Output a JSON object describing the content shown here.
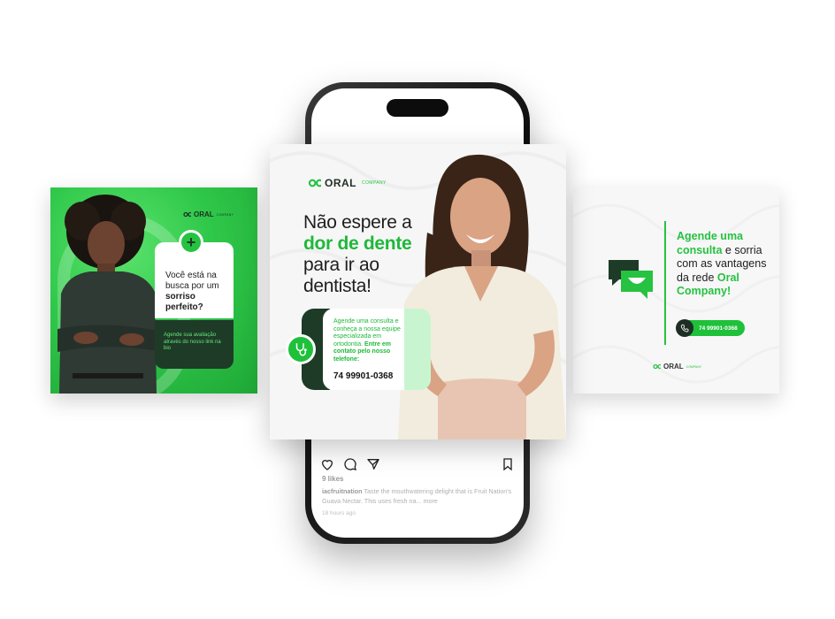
{
  "colors": {
    "brand_green": "#26c241",
    "dark_green": "#1e3b27",
    "mint": "#c8f5d0"
  },
  "instagram": {
    "likes": "9 likes",
    "username": "iacfruitnation",
    "caption": "Taste the mouthwatering delight that is Fruit Nation's Guava Nectar. This uses fresh na...",
    "more": "more",
    "time": "18 hours ago",
    "icons": [
      "heart-icon",
      "comment-icon",
      "share-icon",
      "bookmark-icon"
    ]
  },
  "left_card": {
    "logo": "ORAL",
    "logo_small": "COMPANY",
    "question_1": "Você está na busca por um",
    "question_bold": "sorriso perfeito?",
    "note": "Agende sua avaliação através do nosso link na bio"
  },
  "center_card": {
    "logo": "ORAL",
    "logo_small": "COMPANY",
    "headline_1": "Não espere a",
    "headline_green": "dor de dente",
    "headline_2": "para ir ao dentista!",
    "box_text": "Agende uma consulta e conheça a nossa equipe especializada em ortodontia.",
    "box_text_bold": "Entre em contato pelo nosso telefone:",
    "phone": "74 99901-0368"
  },
  "right_card": {
    "green_1": "Agende uma consulta",
    "text_1": "e sorria com as vantagens da rede",
    "green_2": "Oral Company!",
    "phone": "74 99901-0368",
    "logo": "ORAL",
    "logo_small": "COMPANY"
  }
}
